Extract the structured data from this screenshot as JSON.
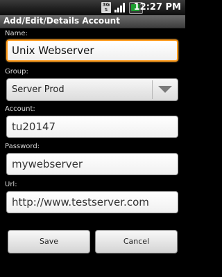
{
  "status": {
    "network": "3G",
    "time": "12:27 PM"
  },
  "title": "Add/Edit/Details Account",
  "form": {
    "name_label": "Name:",
    "name_value": "Unix Webserver",
    "group_label": "Group:",
    "group_value": "Server Prod",
    "account_label": "Account:",
    "account_value": "tu20147",
    "password_label": "Password:",
    "password_value": "mywebserver",
    "url_label": "Url:",
    "url_value": "http://www.testserver.com"
  },
  "buttons": {
    "save": "Save",
    "cancel": "Cancel"
  },
  "colors": {
    "focus_border": "#ff9b1a",
    "battery": "#1c9e2f"
  }
}
